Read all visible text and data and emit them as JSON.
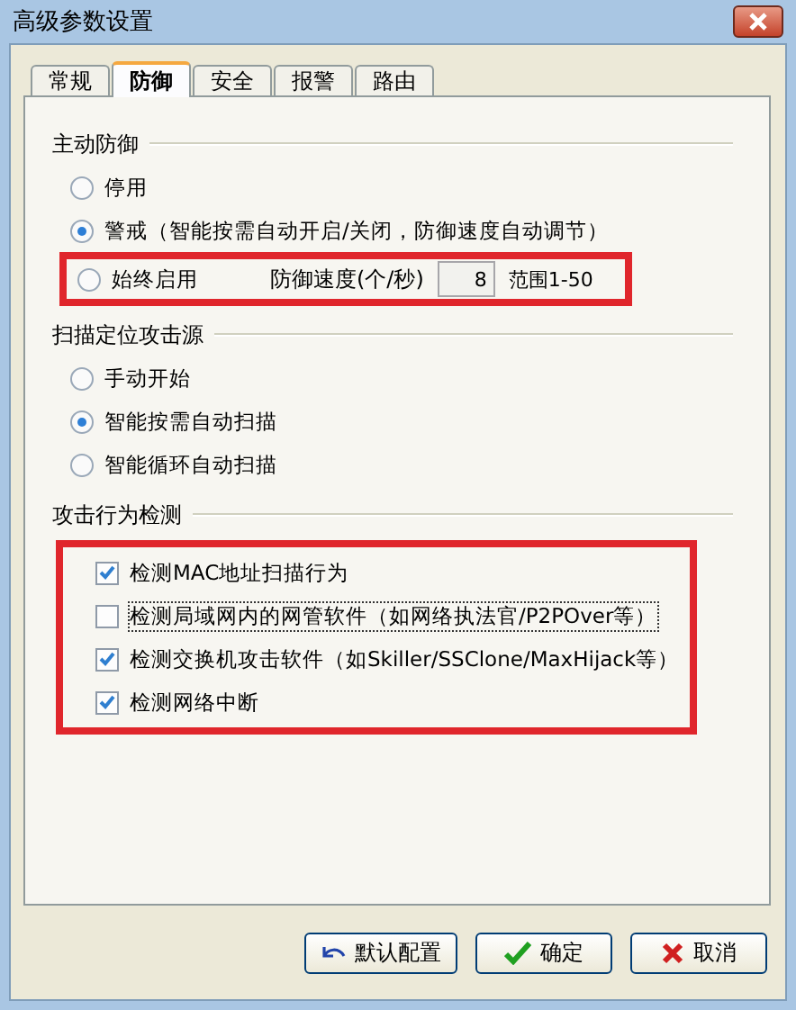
{
  "window": {
    "title": "高级参数设置"
  },
  "tabs": [
    {
      "label": "常规",
      "selected": false
    },
    {
      "label": "防御",
      "selected": true
    },
    {
      "label": "安全",
      "selected": false
    },
    {
      "label": "报警",
      "selected": false
    },
    {
      "label": "路由",
      "selected": false
    }
  ],
  "sections": [
    {
      "title": "主动防御",
      "kind": "radio",
      "highlighted": false,
      "options": [
        {
          "label": "停用",
          "selected": false,
          "highlighted": false
        },
        {
          "label": "警戒（智能按需自动开启/关闭，防御速度自动调节）",
          "selected": true,
          "highlighted": false
        },
        {
          "label": "始终启用",
          "selected": false,
          "highlighted": true,
          "speed": {
            "label": "防御速度(个/秒)",
            "value": "8",
            "range": "范围1-50"
          }
        }
      ]
    },
    {
      "title": "扫描定位攻击源",
      "kind": "radio",
      "highlighted": false,
      "options": [
        {
          "label": "手动开始",
          "selected": false,
          "highlighted": false
        },
        {
          "label": "智能按需自动扫描",
          "selected": true,
          "highlighted": false
        },
        {
          "label": "智能循环自动扫描",
          "selected": false,
          "highlighted": false
        }
      ]
    },
    {
      "title": "攻击行为检测",
      "kind": "check",
      "highlighted": true,
      "options": [
        {
          "label": "检测MAC地址扫描行为",
          "checked": true,
          "focused": false
        },
        {
          "label": "检测局域网内的网管软件（如网络执法官/P2POver等）",
          "checked": false,
          "focused": true
        },
        {
          "label": "检测交换机攻击软件（如Skiller/SSClone/MaxHijack等）",
          "checked": true,
          "focused": false
        },
        {
          "label": "检测网络中断",
          "checked": true,
          "focused": false
        }
      ]
    }
  ],
  "buttons": [
    {
      "label": "默认配置",
      "kind": "reset"
    },
    {
      "label": "确定",
      "kind": "ok"
    },
    {
      "label": "取消",
      "kind": "cancel"
    }
  ]
}
